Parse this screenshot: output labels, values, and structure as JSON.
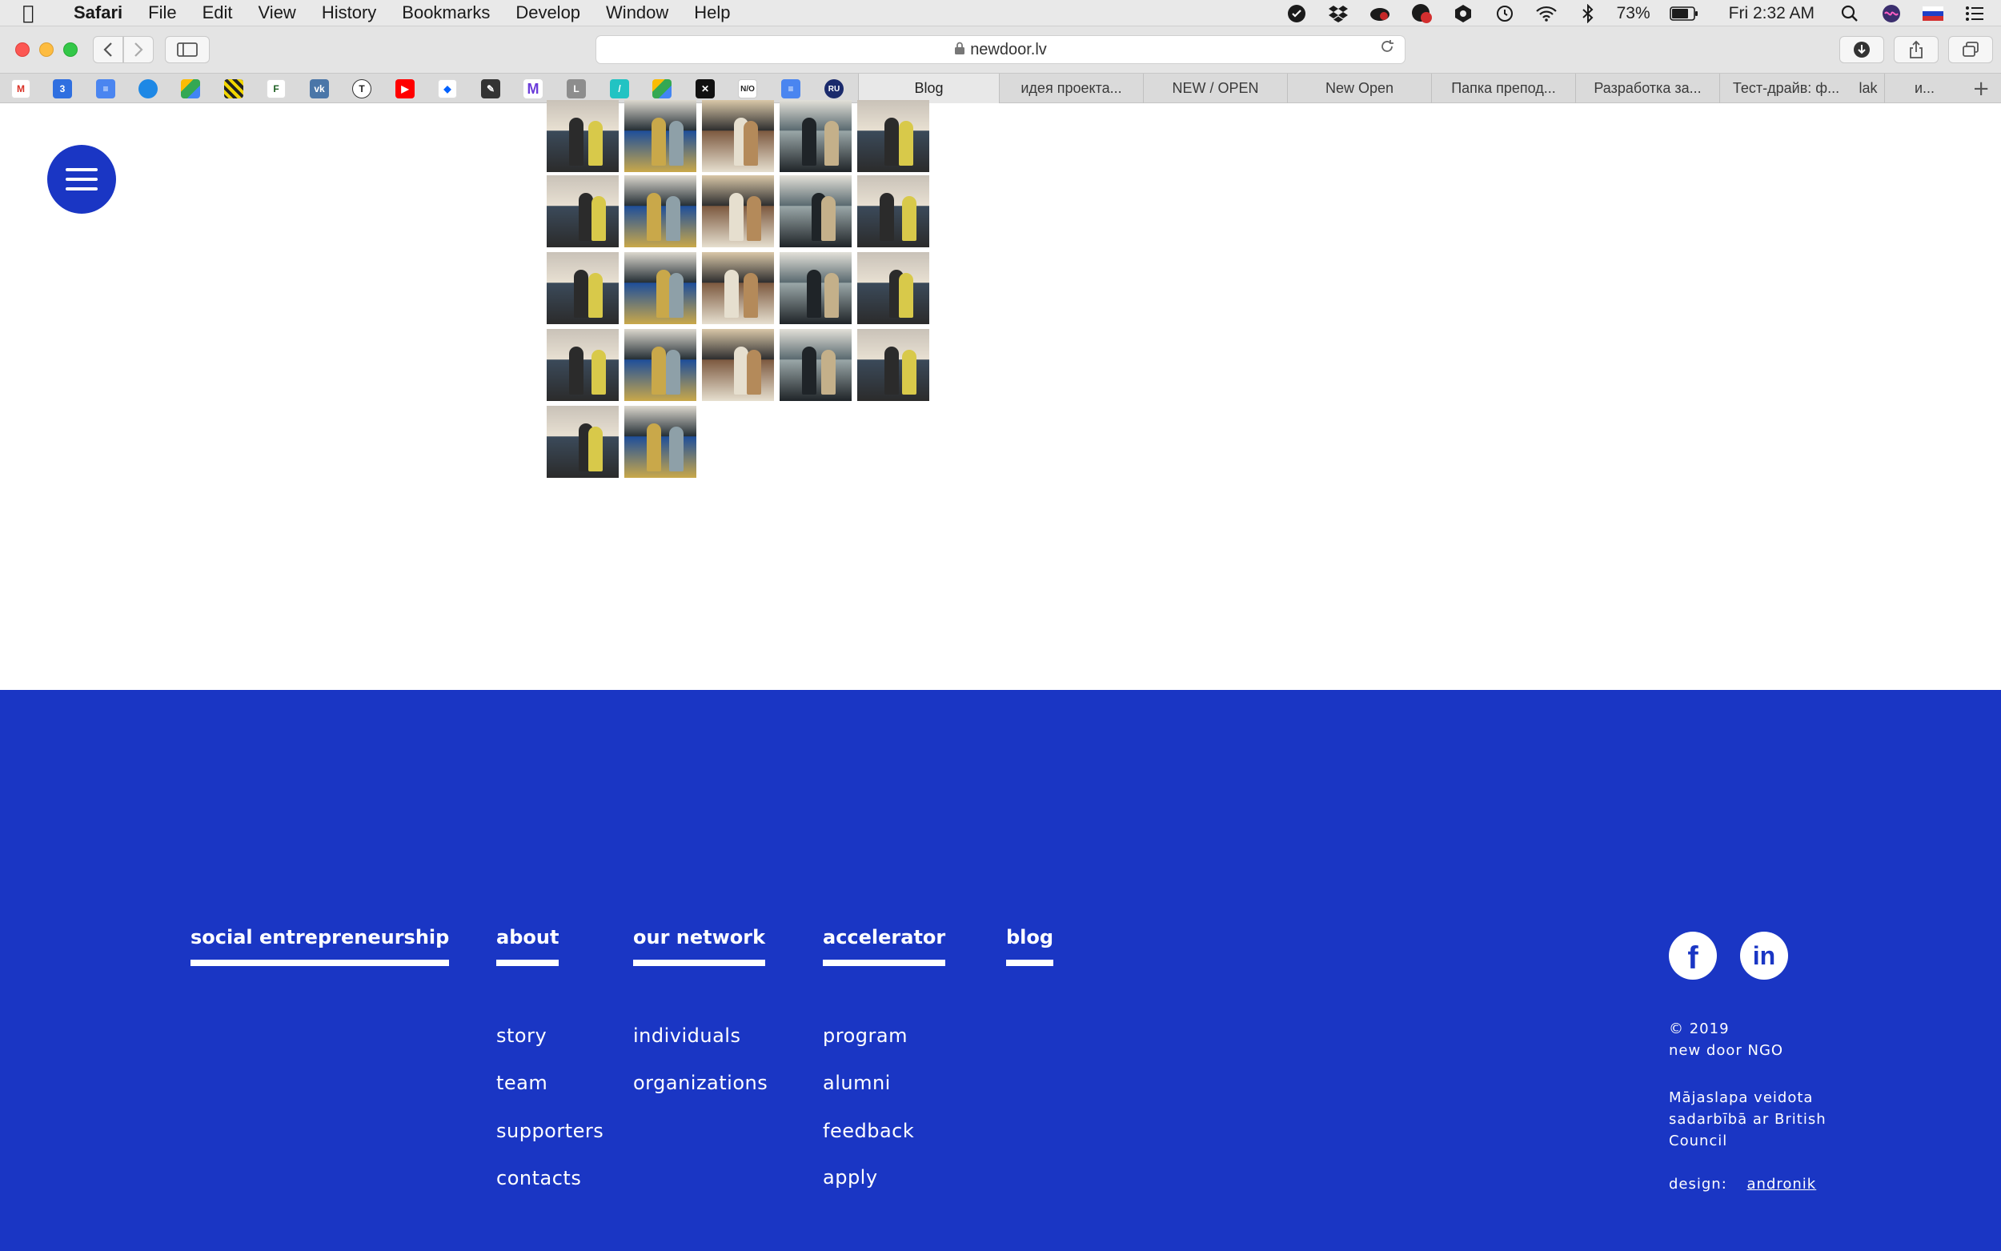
{
  "menubar": {
    "app": "Safari",
    "items": [
      "File",
      "Edit",
      "View",
      "History",
      "Bookmarks",
      "Develop",
      "Window",
      "Help"
    ],
    "battery": "73%",
    "clock": "Fri 2:32 AM"
  },
  "browser": {
    "url": "newdoor.lv"
  },
  "tabs": [
    {
      "label": "Blog",
      "active": true
    },
    {
      "label": "идея проекта..."
    },
    {
      "label": "NEW / OPEN"
    },
    {
      "label": "New Open"
    },
    {
      "label": "Папка препод..."
    },
    {
      "label": "Разработка за..."
    },
    {
      "label": "Тест-драйв: ф..."
    },
    {
      "label": "lak"
    },
    {
      "label": "и..."
    }
  ],
  "footer": {
    "columns": [
      {
        "title": "social entrepreneurship",
        "links": []
      },
      {
        "title": "about",
        "links": [
          "story",
          "team",
          "supporters",
          "contacts"
        ]
      },
      {
        "title": "our network",
        "links": [
          "individuals",
          "organizations"
        ]
      },
      {
        "title": "accelerator",
        "links": [
          "program",
          "alumni",
          "feedback",
          "apply"
        ]
      },
      {
        "title": "blog",
        "links": []
      }
    ],
    "social": {
      "facebook": "f",
      "linkedin": "in"
    },
    "copyright_year": "© 2019",
    "copyright_org": "new door NGO",
    "credit_line1": "Mājaslapa veidota",
    "credit_line2": "sadarbībā ar British",
    "credit_line3": "Council",
    "design_label": "design:",
    "design_link": "andronik"
  },
  "colors": {
    "brand_blue": "#1a36c4"
  }
}
